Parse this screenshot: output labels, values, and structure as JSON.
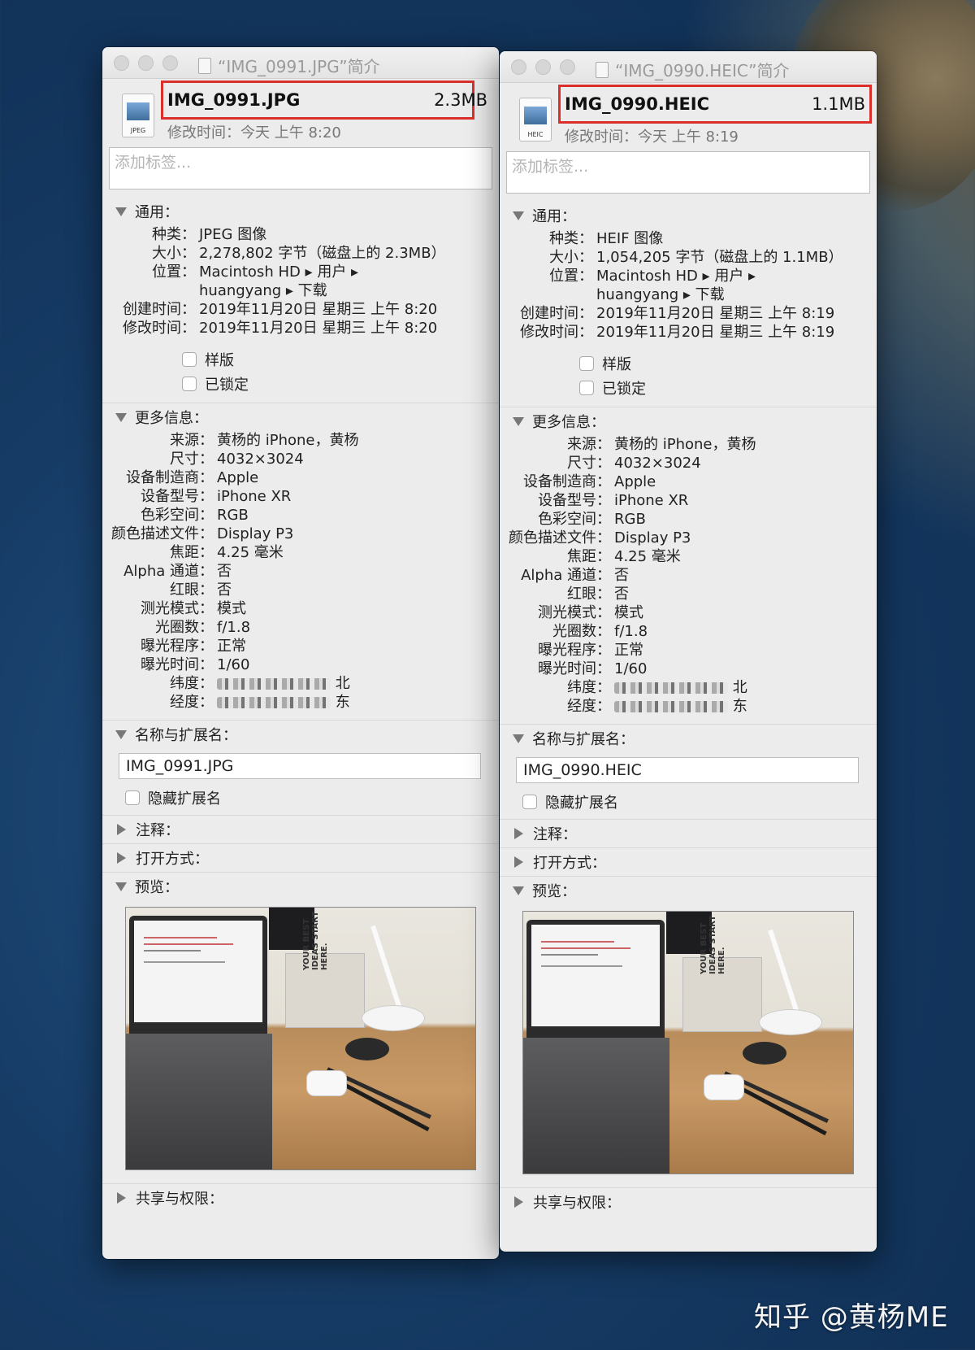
{
  "watermark": "知乎 @黄杨ME",
  "windows": [
    {
      "title": "“IMG_0991.JPG”简介",
      "icon_tag": "JPEG",
      "filename": "IMG_0991.JPG",
      "size": "2.3MB",
      "modified": "修改时间：今天 上午 8:20",
      "tags_placeholder": "添加标签...",
      "general": {
        "header": "通用：",
        "rows": [
          {
            "k": "种类：",
            "v": "JPEG 图像"
          },
          {
            "k": "大小：",
            "v": "2,278,802 字节（磁盘上的 2.3MB）"
          },
          {
            "k": "位置：",
            "v": "Macintosh HD ▸ 用户 ▸ huangyang ▸ 下载"
          },
          {
            "k": "创建时间：",
            "v": "2019年11月20日 星期三 上午 8:20"
          },
          {
            "k": "修改时间：",
            "v": "2019年11月20日 星期三 上午 8:20"
          }
        ],
        "stationery": "样版",
        "locked": "已锁定"
      },
      "more": {
        "header": "更多信息：",
        "rows": [
          {
            "k": "来源：",
            "v": "黄杨的 iPhone，黄杨"
          },
          {
            "k": "尺寸：",
            "v": "4032×3024"
          },
          {
            "k": "设备制造商：",
            "v": "Apple"
          },
          {
            "k": "设备型号：",
            "v": "iPhone XR"
          },
          {
            "k": "色彩空间：",
            "v": "RGB"
          },
          {
            "k": "颜色描述文件：",
            "v": "Display P3"
          },
          {
            "k": "焦距：",
            "v": "4.25 毫米"
          },
          {
            "k": "Alpha 通道：",
            "v": "否"
          },
          {
            "k": "红眼：",
            "v": "否"
          },
          {
            "k": "测光模式：",
            "v": "模式"
          },
          {
            "k": "光圈数：",
            "v": "f/1.8"
          },
          {
            "k": "曝光程序：",
            "v": "正常"
          },
          {
            "k": "曝光时间：",
            "v": "1/60"
          }
        ],
        "lat_label": "纬度：",
        "lat_suffix": "北",
        "lon_label": "经度：",
        "lon_suffix": "东"
      },
      "name_ext": {
        "header": "名称与扩展名：",
        "value": "IMG_0991.JPG",
        "hide_ext": "隐藏扩展名"
      },
      "comments": "注释：",
      "open_with": "打开方式：",
      "preview": "预览：",
      "sharing": "共享与权限："
    },
    {
      "title": "“IMG_0990.HEIC”简介",
      "icon_tag": "HEIC",
      "filename": "IMG_0990.HEIC",
      "size": "1.1MB",
      "modified": "修改时间：今天 上午 8:19",
      "tags_placeholder": "添加标签...",
      "general": {
        "header": "通用：",
        "rows": [
          {
            "k": "种类：",
            "v": "HEIF 图像"
          },
          {
            "k": "大小：",
            "v": "1,054,205 字节（磁盘上的 1.1MB）"
          },
          {
            "k": "位置：",
            "v": "Macintosh HD ▸ 用户 ▸ huangyang ▸ 下载"
          },
          {
            "k": "创建时间：",
            "v": "2019年11月20日 星期三 上午 8:19"
          },
          {
            "k": "修改时间：",
            "v": "2019年11月20日 星期三 上午 8:19"
          }
        ],
        "stationery": "样版",
        "locked": "已锁定"
      },
      "more": {
        "header": "更多信息：",
        "rows": [
          {
            "k": "来源：",
            "v": "黄杨的 iPhone，黄杨"
          },
          {
            "k": "尺寸：",
            "v": "4032×3024"
          },
          {
            "k": "设备制造商：",
            "v": "Apple"
          },
          {
            "k": "设备型号：",
            "v": "iPhone XR"
          },
          {
            "k": "色彩空间：",
            "v": "RGB"
          },
          {
            "k": "颜色描述文件：",
            "v": "Display P3"
          },
          {
            "k": "焦距：",
            "v": "4.25 毫米"
          },
          {
            "k": "Alpha 通道：",
            "v": "否"
          },
          {
            "k": "红眼：",
            "v": "否"
          },
          {
            "k": "测光模式：",
            "v": "模式"
          },
          {
            "k": "光圈数：",
            "v": "f/1.8"
          },
          {
            "k": "曝光程序：",
            "v": "正常"
          },
          {
            "k": "曝光时间：",
            "v": "1/60"
          }
        ],
        "lat_label": "纬度：",
        "lat_suffix": "北",
        "lon_label": "经度：",
        "lon_suffix": "东"
      },
      "name_ext": {
        "header": "名称与扩展名：",
        "value": "IMG_0990.HEIC",
        "hide_ext": "隐藏扩展名"
      },
      "comments": "注释：",
      "open_with": "打开方式：",
      "preview": "预览：",
      "sharing": "共享与权限："
    }
  ]
}
